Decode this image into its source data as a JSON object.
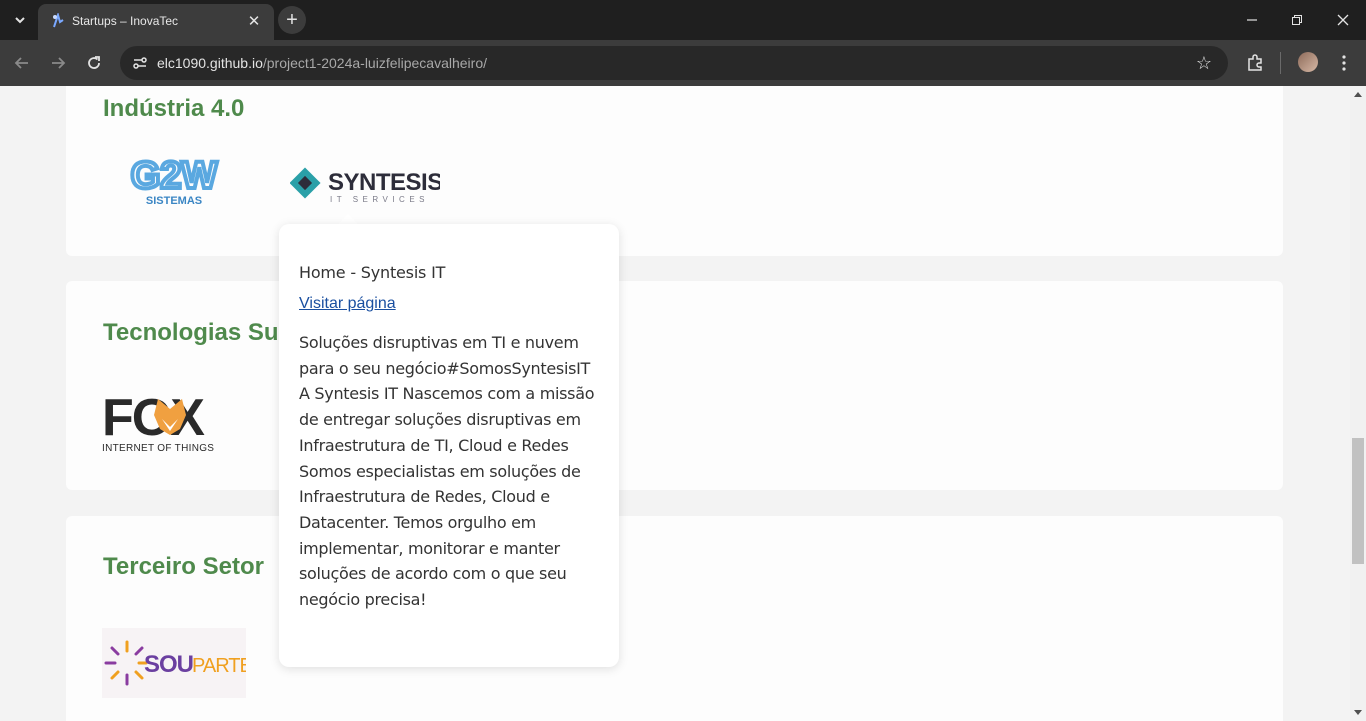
{
  "browser": {
    "tab_title": "Startups – InovaTec",
    "url_host": "elc1090.github.io",
    "url_path": "/project1-2024a-luizfelipecavalheiro/"
  },
  "sections": [
    {
      "title": "Indústria 4.0",
      "logos": [
        {
          "name": "G2W",
          "sub": "SISTEMAS"
        },
        {
          "name": "SYNTESIS",
          "sub": "IT SERVICES"
        }
      ]
    },
    {
      "title": "Tecnologias Su",
      "logos": [
        {
          "name": "FOX",
          "sub": "INTERNET OF THINGS"
        }
      ]
    },
    {
      "title": "Terceiro Setor",
      "logos": [
        {
          "name": "SOU",
          "name2": "PARTE"
        }
      ]
    }
  ],
  "popover": {
    "title": "Home - Syntesis IT",
    "link": "Visitar página",
    "description": "Soluções disruptivas em TI e nuvem para o seu negócio#SomosSyntesisIT A Syntesis IT Nascemos com a missão de entregar soluções disruptivas em Infraestrutura de TI, Cloud e Redes Somos especialistas em soluções de Infraestrutura de Redes, Cloud e Datacenter. Temos orgulho em implementar, monitorar e manter soluções de acordo com o que seu negócio precisa!"
  },
  "colors": {
    "heading": "#4f8a4c",
    "link": "#1a4fa0",
    "g2w_blue": "#5aa8e0",
    "syntesis_teal": "#2aa0a8",
    "fox_orange": "#f0a040"
  }
}
